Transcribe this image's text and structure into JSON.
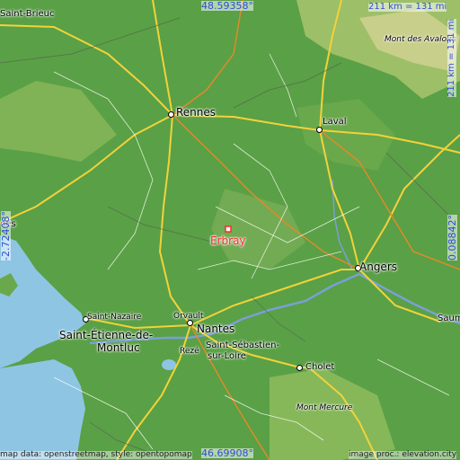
{
  "map": {
    "coords": {
      "top": "48.59358°",
      "bottom": "46.69908°",
      "left": "-2.72408°",
      "right": "0.08842°"
    },
    "scale_top": "211 km = 131 mi",
    "scale_right": "211 km = 131 mi",
    "credits": {
      "left": "map data: openstreetmap, style: opentopomap",
      "right": "image proc.: elevation.city"
    },
    "marker": {
      "label": "Erbray",
      "color": "#ff2a2a"
    },
    "places": {
      "saint_brieuc": "Saint-Brieuc",
      "rennes": "Rennes",
      "laval": "Laval",
      "mont_avaloirs": "Mont des Avaloirs",
      "vannes": "nes",
      "angers": "Angers",
      "saint_nazaire": "Saint-Nazaire",
      "orvault": "Orvault",
      "nantes": "Nantes",
      "saint_etienne_1": "Saint-Étienne-de-",
      "saint_etienne_2": "Montluc",
      "reze": "Rezé",
      "saint_sebastien_1": "Saint-Sébastien-",
      "saint_sebastien_2": "sur-Loire",
      "cholet": "Cholet",
      "saumur": "Saum",
      "mont_mercure": "Mont Mercure"
    },
    "colors": {
      "sea": "#8ec5e3",
      "lowland": "#5aa046",
      "highland": "#c8cf8a",
      "road": "#f2d23a",
      "river": "#7a9fd6",
      "marker": "#ff2a2a"
    }
  }
}
